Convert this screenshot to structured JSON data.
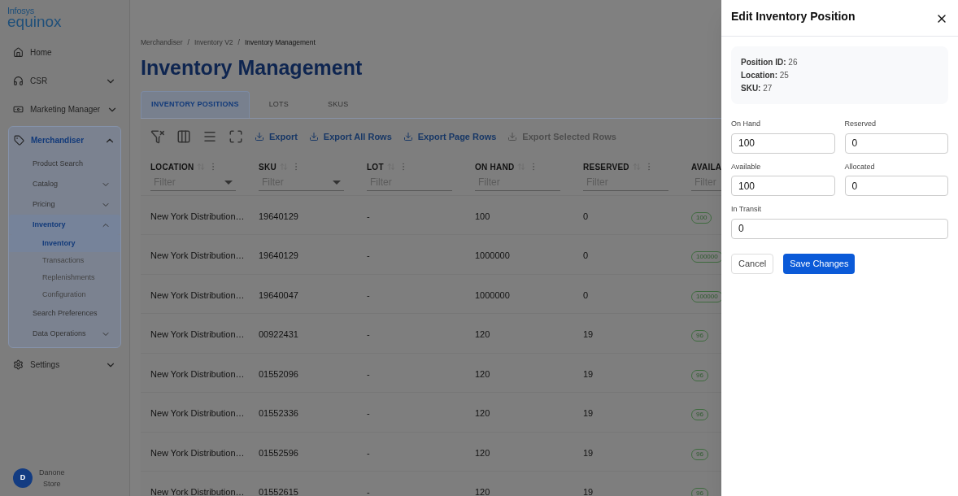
{
  "logo": {
    "top": "Infosys",
    "bottom": "equinox"
  },
  "sidebar": {
    "items": [
      {
        "label": "Home",
        "selected": false
      },
      {
        "label": "CSR",
        "expanded": false,
        "selected": false
      },
      {
        "label": "Marketing Manager",
        "expanded": false,
        "selected": false
      },
      {
        "label": "Merchandiser",
        "expanded": true,
        "selected": true,
        "children": [
          {
            "label": "Product Search",
            "selected": false
          },
          {
            "label": "Catalog",
            "expanded": false,
            "selected": false
          },
          {
            "label": "Pricing",
            "expanded": false,
            "selected": false
          },
          {
            "label": "Inventory",
            "expanded": true,
            "selected": true,
            "children": [
              {
                "label": "Inventory",
                "selected": true
              },
              {
                "label": "Transactions",
                "selected": false
              },
              {
                "label": "Replenishments",
                "selected": false
              },
              {
                "label": "Configuration",
                "selected": false
              }
            ]
          },
          {
            "label": "Search Preferences",
            "selected": false
          },
          {
            "label": "Data Operations",
            "expanded": false,
            "selected": false
          }
        ]
      },
      {
        "label": "Settings",
        "expanded": false,
        "selected": false
      }
    ]
  },
  "user": {
    "initial": "D",
    "name": "Danone",
    "role": "Store"
  },
  "breadcrumb": {
    "separator": "/",
    "items": [
      "Merchandiser",
      "Inventory V2",
      "Inventory Management"
    ]
  },
  "page_title": "Inventory Management",
  "tabs": [
    {
      "label": "INVENTORY POSITIONS",
      "selected": true
    },
    {
      "label": "LOTS",
      "selected": false
    },
    {
      "label": "SKUS",
      "selected": false
    }
  ],
  "toolbar": {
    "actions": [
      {
        "label": "Export",
        "disabled": false
      },
      {
        "label": "Export All Rows",
        "disabled": false
      },
      {
        "label": "Export Page Rows",
        "disabled": false
      },
      {
        "label": "Export Selected Rows",
        "disabled": true
      }
    ]
  },
  "table": {
    "columns": [
      {
        "label": "LOCATION",
        "filter": "Filter",
        "kind": "select"
      },
      {
        "label": "SKU",
        "filter": "Filter",
        "kind": "select"
      },
      {
        "label": "LOT",
        "filter": "Filter",
        "kind": "text"
      },
      {
        "label": "ON HAND",
        "filter": "Filter",
        "kind": "text"
      },
      {
        "label": "RESERVED",
        "filter": "Filter",
        "kind": "text"
      },
      {
        "label": "AVAILA",
        "filter": "Filter",
        "kind": "text"
      }
    ],
    "rows": [
      [
        "New York Distribution…",
        "19640129",
        "-",
        "100",
        "0",
        "100"
      ],
      [
        "New York Distribution…",
        "19640129",
        "-",
        "1000000",
        "0",
        "100000"
      ],
      [
        "New York Distribution…",
        "19640047",
        "-",
        "1000000",
        "0",
        "100000"
      ],
      [
        "New York Distribution…",
        "00922431",
        "-",
        "120",
        "19",
        "96"
      ],
      [
        "New York Distribution…",
        "01552096",
        "-",
        "120",
        "19",
        "96"
      ],
      [
        "New York Distribution…",
        "01552336",
        "-",
        "120",
        "19",
        "96"
      ],
      [
        "New York Distribution…",
        "01552596",
        "-",
        "120",
        "19",
        "96"
      ],
      [
        "New York Distribution…",
        "01552615",
        "-",
        "120",
        "19",
        "96"
      ]
    ]
  },
  "drawer": {
    "title": "Edit Inventory Position",
    "info": [
      {
        "label": "Position ID:",
        "value": "26"
      },
      {
        "label": "Location:",
        "value": "25"
      },
      {
        "label": "SKU:",
        "value": "27"
      }
    ],
    "fields": [
      {
        "label": "On Hand",
        "value": "100",
        "wide": false
      },
      {
        "label": "Reserved",
        "value": "0",
        "wide": false
      },
      {
        "label": "Available",
        "value": "100",
        "wide": false
      },
      {
        "label": "Allocated",
        "value": "0",
        "wide": false
      },
      {
        "label": "In Transit",
        "value": "0",
        "wide": true
      }
    ],
    "buttons": [
      {
        "label": "Cancel",
        "kind": "secondary"
      },
      {
        "label": "Save Changes",
        "kind": "primary"
      }
    ]
  }
}
